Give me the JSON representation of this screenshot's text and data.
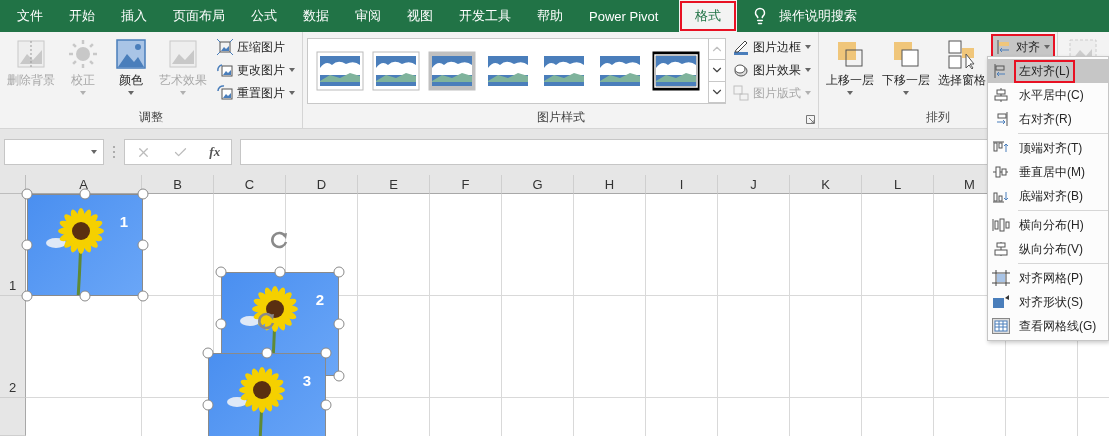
{
  "tabs": [
    {
      "label": "文件",
      "selected": false,
      "highlighted": false
    },
    {
      "label": "开始",
      "selected": false,
      "highlighted": false
    },
    {
      "label": "插入",
      "selected": false,
      "highlighted": false
    },
    {
      "label": "页面布局",
      "selected": false,
      "highlighted": false
    },
    {
      "label": "公式",
      "selected": false,
      "highlighted": false
    },
    {
      "label": "数据",
      "selected": false,
      "highlighted": false
    },
    {
      "label": "审阅",
      "selected": false,
      "highlighted": false
    },
    {
      "label": "视图",
      "selected": false,
      "highlighted": false
    },
    {
      "label": "开发工具",
      "selected": false,
      "highlighted": false
    },
    {
      "label": "帮助",
      "selected": false,
      "highlighted": false
    },
    {
      "label": "Power Pivot",
      "selected": false,
      "highlighted": false
    },
    {
      "label": "格式",
      "selected": true,
      "highlighted": true
    }
  ],
  "tell_me": "操作说明搜索",
  "ribbon": {
    "groups": [
      {
        "title": "调整",
        "large_buttons": [
          {
            "label": "删除背景",
            "disabled": true,
            "dropdown": false
          },
          {
            "label": "校正",
            "disabled": true,
            "dropdown": true
          },
          {
            "label": "颜色",
            "disabled": false,
            "dropdown": true
          },
          {
            "label": "艺术效果",
            "disabled": true,
            "dropdown": true
          }
        ],
        "small_buttons": [
          {
            "label": "压缩图片",
            "disabled": false,
            "dropdown": false,
            "highlighted": false
          },
          {
            "label": "更改图片",
            "disabled": false,
            "dropdown": true,
            "highlighted": false
          },
          {
            "label": "重置图片",
            "disabled": false,
            "dropdown": true,
            "highlighted": false
          }
        ]
      },
      {
        "title": "图片样式",
        "launcher": true,
        "gallery": {
          "up_disabled": true
        },
        "small_buttons": [
          {
            "label": "图片边框",
            "disabled": false,
            "dropdown": true,
            "highlighted": false
          },
          {
            "label": "图片效果",
            "disabled": false,
            "dropdown": true,
            "highlighted": false
          },
          {
            "label": "图片版式",
            "disabled": true,
            "dropdown": true,
            "highlighted": false
          }
        ]
      },
      {
        "title": "排列",
        "large_buttons": [
          {
            "label": "上移一层",
            "disabled": false,
            "dropdown": true
          },
          {
            "label": "下移一层",
            "disabled": false,
            "dropdown": true
          },
          {
            "label": "选择窗格",
            "disabled": false,
            "dropdown": false
          }
        ],
        "small_buttons": [
          {
            "label": "对齐",
            "disabled": false,
            "dropdown": true,
            "highlighted": true
          }
        ]
      }
    ]
  },
  "formula_bar": {
    "function_label": "fx"
  },
  "columns": [
    "A",
    "B",
    "C",
    "D",
    "E",
    "F",
    "G",
    "H",
    "I",
    "J",
    "K",
    "L",
    "M"
  ],
  "rows": [
    "1",
    "2"
  ],
  "pictures": [
    {
      "label": "1",
      "selected": true
    },
    {
      "label": "2",
      "selected": true
    },
    {
      "label": "3",
      "selected": true
    }
  ],
  "align_menu": {
    "groups": [
      [
        {
          "label": "左对齐(L)",
          "selected": true,
          "highlighted": true
        },
        {
          "label": "水平居中(C)",
          "selected": false,
          "highlighted": false
        },
        {
          "label": "右对齐(R)",
          "selected": false,
          "highlighted": false
        }
      ],
      [
        {
          "label": "顶端对齐(T)",
          "selected": false,
          "highlighted": false
        },
        {
          "label": "垂直居中(M)",
          "selected": false,
          "highlighted": false
        },
        {
          "label": "底端对齐(B)",
          "selected": false,
          "highlighted": false
        }
      ],
      [
        {
          "label": "横向分布(H)",
          "selected": false,
          "highlighted": false
        },
        {
          "label": "纵向分布(V)",
          "selected": false,
          "highlighted": false
        }
      ],
      [
        {
          "label": "对齐网格(P)",
          "selected": false,
          "highlighted": false
        },
        {
          "label": "对齐形状(S)",
          "selected": false,
          "highlighted": false
        },
        {
          "label": "查看网格线(G)",
          "selected": false,
          "highlighted": false
        }
      ]
    ]
  }
}
